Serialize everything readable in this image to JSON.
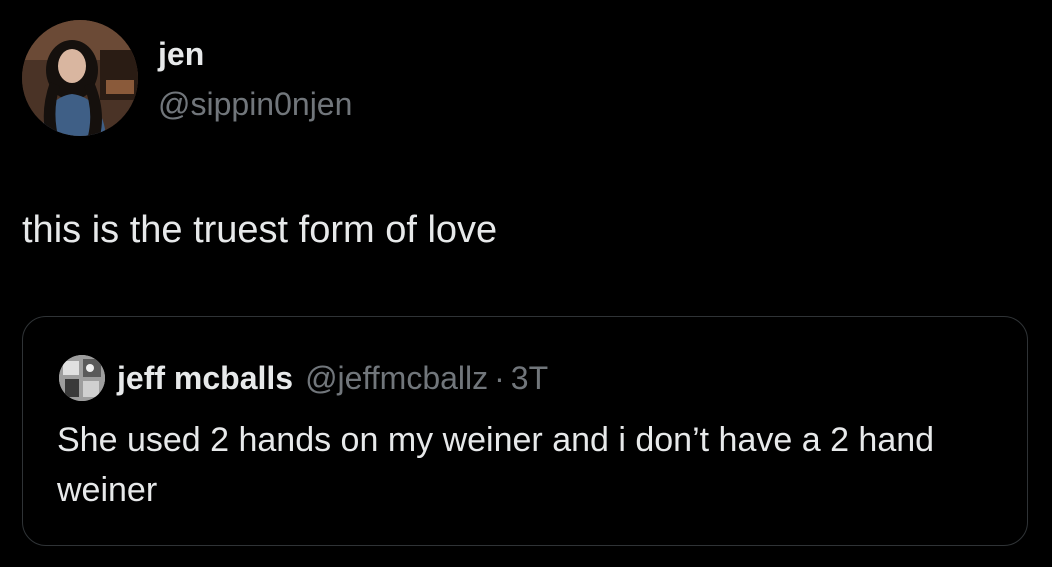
{
  "tweet": {
    "author": {
      "name": "jen",
      "handle": "@sippin0njen"
    },
    "text": "this is the truest form of love",
    "quoted": {
      "author": {
        "name": "jeff mcballs",
        "handle": "@jeffmcballz"
      },
      "separator": "·",
      "timestamp": "3T",
      "text": "She used 2 hands on my weiner and i don’t have a 2 hand weiner"
    }
  },
  "colors": {
    "background": "#000000",
    "primary_text": "#e7e9ea",
    "secondary_text": "#71767b",
    "card_border": "#2f3336"
  }
}
